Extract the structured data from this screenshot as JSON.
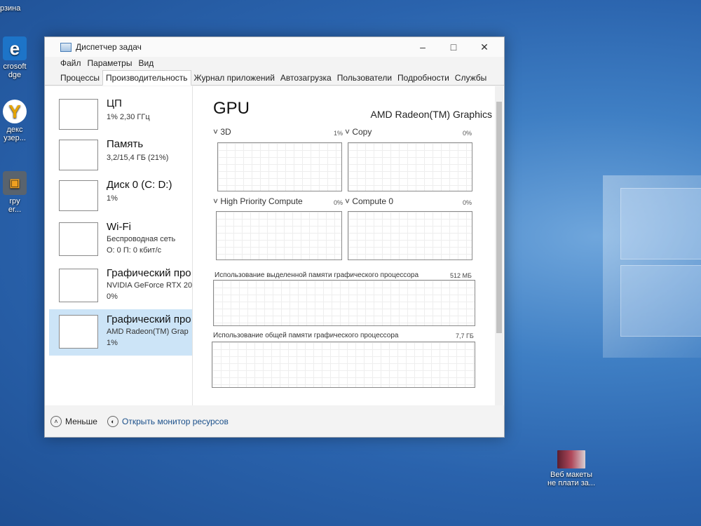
{
  "desktop": {
    "top_label": "рзина",
    "icons": [
      {
        "label1": "crosoft",
        "label2": "dge",
        "icon": "edge-icon"
      },
      {
        "label1": "декс",
        "label2": "узер...",
        "icon": "yandex-icon"
      },
      {
        "label1": "rpy",
        "label2": "er...",
        "icon": "app-icon"
      }
    ],
    "bottom_icon": {
      "line1": "Веб макеты",
      "line2": "не плати за..."
    }
  },
  "window": {
    "title": "Диспетчер задач",
    "menu": [
      "Файл",
      "Параметры",
      "Вид"
    ],
    "tabs": [
      "Процессы",
      "Производительность",
      "Журнал приложений",
      "Автозагрузка",
      "Пользователи",
      "Подробности",
      "Службы"
    ],
    "active_tab": 1
  },
  "sidebar": [
    {
      "title": "ЦП",
      "sub1": "1% 2,30 ГГц",
      "sub2": ""
    },
    {
      "title": "Память",
      "sub1": "3,2/15,4 ГБ (21%)",
      "sub2": ""
    },
    {
      "title": "Диск 0 (C: D:)",
      "sub1": "1%",
      "sub2": ""
    },
    {
      "title": "Wi-Fi",
      "sub1": "Беспроводная сеть",
      "sub2": "О: 0 П: 0 кбит/с"
    },
    {
      "title": "Графический про",
      "sub1": "NVIDIA GeForce RTX 20",
      "sub2": "0%"
    },
    {
      "title": "Графический про",
      "sub1": "AMD Radeon(TM) Grap",
      "sub2": "1%"
    }
  ],
  "main": {
    "title": "GPU",
    "device": "AMD Radeon(TM) Graphics",
    "engines": [
      {
        "label": "3D",
        "pct": "1%"
      },
      {
        "label": "Copy",
        "pct": "0%"
      },
      {
        "label": "High Priority Compute",
        "pct": "0%"
      },
      {
        "label": "Compute 0",
        "pct": "0%"
      }
    ],
    "dedicated_label": "Использование выделенной памяти графического процессора",
    "dedicated_value": "512 МБ",
    "shared_label": "Использование общей памяти графического процессора",
    "shared_value": "7,7 ГБ"
  },
  "footer": {
    "less": "Меньше",
    "monitor": "Открыть монитор ресурсов"
  }
}
